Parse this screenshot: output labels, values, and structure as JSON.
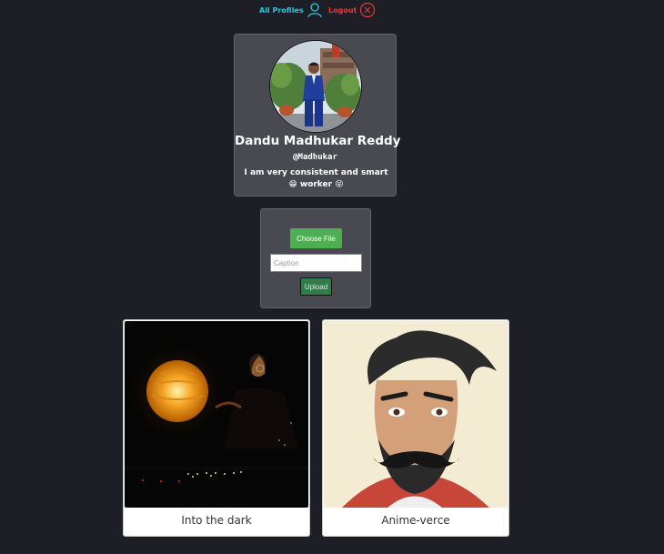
{
  "nav": {
    "all_profiles_label": "All Profiles",
    "all_profiles_icon": "user-icon",
    "logout_label": "Logout",
    "logout_icon": "close-circle-icon"
  },
  "profile": {
    "name": "Dandu Madhukar Reddy",
    "username": "@Madhukar",
    "bio": "I am very consistent and smart 😁 worker 😝"
  },
  "upload": {
    "choose_file_label": "Choose File",
    "caption_placeholder": "Caption",
    "caption_value": "",
    "upload_label": "Upload"
  },
  "posts": [
    {
      "caption": "Into the dark"
    },
    {
      "caption": "Anime-verce"
    }
  ],
  "colors": {
    "background": "#1e1e27",
    "card": "#494952",
    "all_profiles": "#26c6da",
    "logout": "#e53935",
    "choose_file": "#4caf50",
    "upload": "#2e7d4a"
  }
}
